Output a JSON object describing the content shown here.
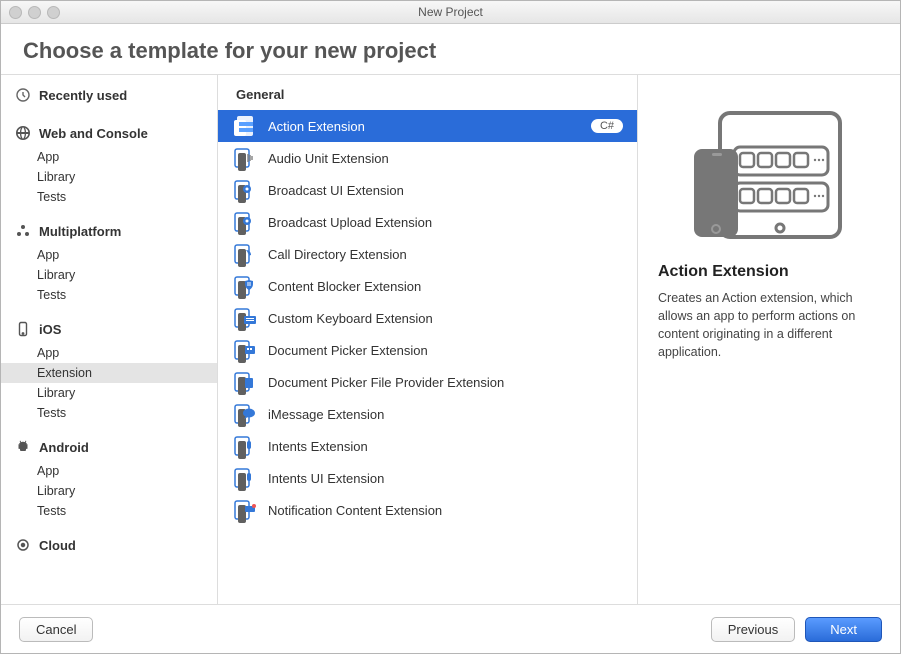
{
  "window": {
    "title": "New Project"
  },
  "heading": "Choose a template for your new project",
  "sidebar": {
    "recent": {
      "label": "Recently used"
    },
    "categories": [
      {
        "key": "web",
        "label": "Web and Console",
        "items": [
          {
            "label": "App"
          },
          {
            "label": "Library"
          },
          {
            "label": "Tests"
          }
        ]
      },
      {
        "key": "multiplatform",
        "label": "Multiplatform",
        "items": [
          {
            "label": "App"
          },
          {
            "label": "Library"
          },
          {
            "label": "Tests"
          }
        ]
      },
      {
        "key": "ios",
        "label": "iOS",
        "items": [
          {
            "label": "App"
          },
          {
            "label": "Extension",
            "active": true
          },
          {
            "label": "Library"
          },
          {
            "label": "Tests"
          }
        ]
      },
      {
        "key": "android",
        "label": "Android",
        "items": [
          {
            "label": "App"
          },
          {
            "label": "Library"
          },
          {
            "label": "Tests"
          }
        ]
      },
      {
        "key": "cloud",
        "label": "Cloud",
        "items": []
      }
    ]
  },
  "templates": {
    "group_label": "General",
    "items": [
      {
        "label": "Action Extension",
        "selected": true,
        "badge": "C#"
      },
      {
        "label": "Audio Unit Extension"
      },
      {
        "label": "Broadcast UI Extension"
      },
      {
        "label": "Broadcast Upload Extension"
      },
      {
        "label": "Call Directory Extension"
      },
      {
        "label": "Content Blocker Extension"
      },
      {
        "label": "Custom Keyboard Extension"
      },
      {
        "label": "Document Picker Extension"
      },
      {
        "label": "Document Picker File Provider Extension"
      },
      {
        "label": "iMessage Extension"
      },
      {
        "label": "Intents Extension"
      },
      {
        "label": "Intents UI Extension"
      },
      {
        "label": "Notification Content Extension"
      }
    ]
  },
  "detail": {
    "title": "Action Extension",
    "description": "Creates an Action extension, which allows an app to perform actions on content originating in a different application."
  },
  "footer": {
    "cancel": "Cancel",
    "previous": "Previous",
    "next": "Next"
  }
}
